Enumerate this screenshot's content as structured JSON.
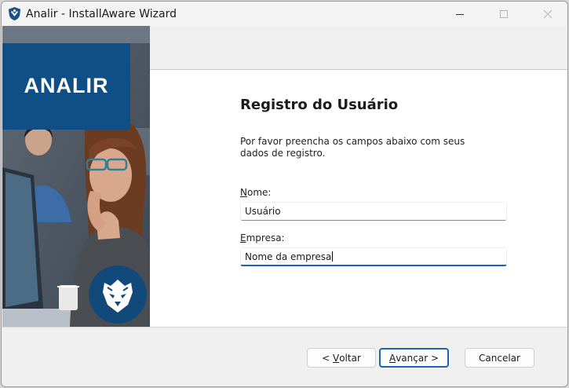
{
  "window": {
    "title": "Analir - InstallAware Wizard"
  },
  "banner": {
    "brand": "ANALIR"
  },
  "page": {
    "heading": "Registro do Usuário",
    "description": "Por favor preencha os campos abaixo com seus dados de registro."
  },
  "form": {
    "name_label_accel": "N",
    "name_label_rest": "ome:",
    "name_value": "Usuário",
    "company_label_accel": "E",
    "company_label_rest": "mpresa:",
    "company_value": "Nome da empresa"
  },
  "buttons": {
    "back_prefix": "< ",
    "back_accel": "V",
    "back_rest": "oltar",
    "next_accel": "A",
    "next_rest": "vançar >",
    "cancel": "Cancelar"
  },
  "colors": {
    "brand_blue": "#0f4f86",
    "focus_blue": "#1b63b2"
  }
}
